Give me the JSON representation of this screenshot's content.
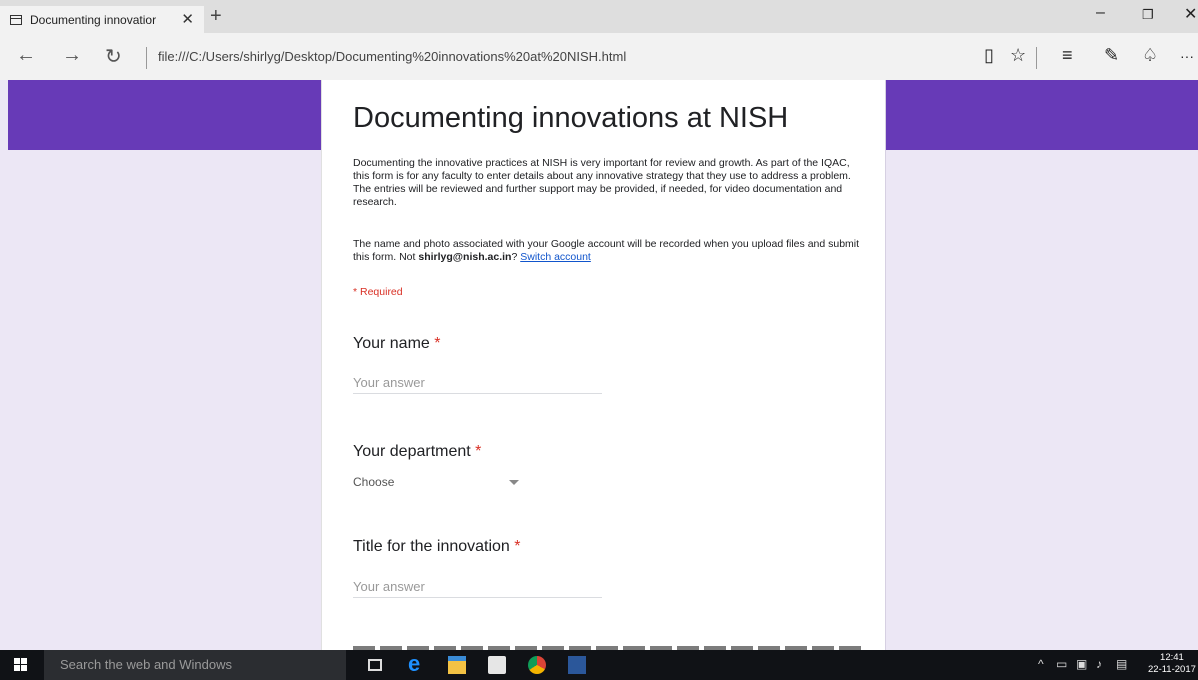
{
  "browser": {
    "tab_title": "Documenting innovatior",
    "tab_close": "✕",
    "new_tab": "+",
    "url": "file:///C:/Users/shirlyg/Desktop/Documenting%20innovations%20at%20NISH.html",
    "window_controls": {
      "minimize": "–",
      "restore": "❐",
      "close": "✕"
    },
    "nav": {
      "back": "←",
      "forward": "→",
      "refresh": "↻"
    },
    "toolbar": {
      "reading_view": "▯",
      "favorite": "☆",
      "hub": "≡",
      "web_note": "✎",
      "share": "♤",
      "more": "···"
    }
  },
  "form": {
    "title": "Documenting innovations at NISH",
    "description": "Documenting the innovative practices at NISH is very important for review and growth. As part of the IQAC, this form is for any faculty to enter details about any innovative strategy that they use to address a problem. The entries will be reviewed and further support may be provided, if needed, for video documentation and research.",
    "account_notice_prefix": "The name and photo associated with your Google account will be recorded when you upload files and submit this form. Not ",
    "account_email": "shirlyg@nish.ac.in",
    "account_notice_suffix": "?",
    "switch_account": "Switch account",
    "required_note": "* Required",
    "questions": [
      {
        "label": "Your name",
        "star": "*",
        "placeholder": "Your answer"
      },
      {
        "label": "Your department",
        "star": "*",
        "select_value": "Choose"
      },
      {
        "label": "Title for the innovation",
        "star": "*",
        "placeholder": "Your answer"
      }
    ]
  },
  "taskbar": {
    "search_placeholder": "Search the web and Windows",
    "time": "12:41",
    "date": "22-11-2017"
  },
  "colors": {
    "header_purple": "#673ab7",
    "page_bg": "#ece7f5",
    "required_red": "#d93025",
    "link_blue": "#1155cc"
  }
}
